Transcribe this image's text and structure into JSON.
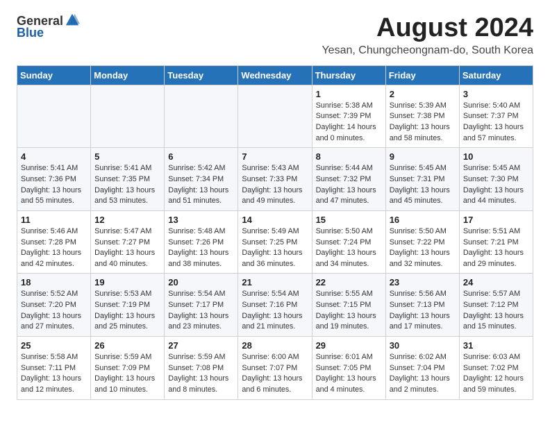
{
  "header": {
    "logo_general": "General",
    "logo_blue": "Blue",
    "month": "August 2024",
    "location": "Yesan, Chungcheongnam-do, South Korea"
  },
  "columns": [
    "Sunday",
    "Monday",
    "Tuesday",
    "Wednesday",
    "Thursday",
    "Friday",
    "Saturday"
  ],
  "rows": [
    [
      {
        "day": "",
        "info": ""
      },
      {
        "day": "",
        "info": ""
      },
      {
        "day": "",
        "info": ""
      },
      {
        "day": "",
        "info": ""
      },
      {
        "day": "1",
        "info": "Sunrise: 5:38 AM\nSunset: 7:39 PM\nDaylight: 14 hours\nand 0 minutes."
      },
      {
        "day": "2",
        "info": "Sunrise: 5:39 AM\nSunset: 7:38 PM\nDaylight: 13 hours\nand 58 minutes."
      },
      {
        "day": "3",
        "info": "Sunrise: 5:40 AM\nSunset: 7:37 PM\nDaylight: 13 hours\nand 57 minutes."
      }
    ],
    [
      {
        "day": "4",
        "info": "Sunrise: 5:41 AM\nSunset: 7:36 PM\nDaylight: 13 hours\nand 55 minutes."
      },
      {
        "day": "5",
        "info": "Sunrise: 5:41 AM\nSunset: 7:35 PM\nDaylight: 13 hours\nand 53 minutes."
      },
      {
        "day": "6",
        "info": "Sunrise: 5:42 AM\nSunset: 7:34 PM\nDaylight: 13 hours\nand 51 minutes."
      },
      {
        "day": "7",
        "info": "Sunrise: 5:43 AM\nSunset: 7:33 PM\nDaylight: 13 hours\nand 49 minutes."
      },
      {
        "day": "8",
        "info": "Sunrise: 5:44 AM\nSunset: 7:32 PM\nDaylight: 13 hours\nand 47 minutes."
      },
      {
        "day": "9",
        "info": "Sunrise: 5:45 AM\nSunset: 7:31 PM\nDaylight: 13 hours\nand 45 minutes."
      },
      {
        "day": "10",
        "info": "Sunrise: 5:45 AM\nSunset: 7:30 PM\nDaylight: 13 hours\nand 44 minutes."
      }
    ],
    [
      {
        "day": "11",
        "info": "Sunrise: 5:46 AM\nSunset: 7:28 PM\nDaylight: 13 hours\nand 42 minutes."
      },
      {
        "day": "12",
        "info": "Sunrise: 5:47 AM\nSunset: 7:27 PM\nDaylight: 13 hours\nand 40 minutes."
      },
      {
        "day": "13",
        "info": "Sunrise: 5:48 AM\nSunset: 7:26 PM\nDaylight: 13 hours\nand 38 minutes."
      },
      {
        "day": "14",
        "info": "Sunrise: 5:49 AM\nSunset: 7:25 PM\nDaylight: 13 hours\nand 36 minutes."
      },
      {
        "day": "15",
        "info": "Sunrise: 5:50 AM\nSunset: 7:24 PM\nDaylight: 13 hours\nand 34 minutes."
      },
      {
        "day": "16",
        "info": "Sunrise: 5:50 AM\nSunset: 7:22 PM\nDaylight: 13 hours\nand 32 minutes."
      },
      {
        "day": "17",
        "info": "Sunrise: 5:51 AM\nSunset: 7:21 PM\nDaylight: 13 hours\nand 29 minutes."
      }
    ],
    [
      {
        "day": "18",
        "info": "Sunrise: 5:52 AM\nSunset: 7:20 PM\nDaylight: 13 hours\nand 27 minutes."
      },
      {
        "day": "19",
        "info": "Sunrise: 5:53 AM\nSunset: 7:19 PM\nDaylight: 13 hours\nand 25 minutes."
      },
      {
        "day": "20",
        "info": "Sunrise: 5:54 AM\nSunset: 7:17 PM\nDaylight: 13 hours\nand 23 minutes."
      },
      {
        "day": "21",
        "info": "Sunrise: 5:54 AM\nSunset: 7:16 PM\nDaylight: 13 hours\nand 21 minutes."
      },
      {
        "day": "22",
        "info": "Sunrise: 5:55 AM\nSunset: 7:15 PM\nDaylight: 13 hours\nand 19 minutes."
      },
      {
        "day": "23",
        "info": "Sunrise: 5:56 AM\nSunset: 7:13 PM\nDaylight: 13 hours\nand 17 minutes."
      },
      {
        "day": "24",
        "info": "Sunrise: 5:57 AM\nSunset: 7:12 PM\nDaylight: 13 hours\nand 15 minutes."
      }
    ],
    [
      {
        "day": "25",
        "info": "Sunrise: 5:58 AM\nSunset: 7:11 PM\nDaylight: 13 hours\nand 12 minutes."
      },
      {
        "day": "26",
        "info": "Sunrise: 5:59 AM\nSunset: 7:09 PM\nDaylight: 13 hours\nand 10 minutes."
      },
      {
        "day": "27",
        "info": "Sunrise: 5:59 AM\nSunset: 7:08 PM\nDaylight: 13 hours\nand 8 minutes."
      },
      {
        "day": "28",
        "info": "Sunrise: 6:00 AM\nSunset: 7:07 PM\nDaylight: 13 hours\nand 6 minutes."
      },
      {
        "day": "29",
        "info": "Sunrise: 6:01 AM\nSunset: 7:05 PM\nDaylight: 13 hours\nand 4 minutes."
      },
      {
        "day": "30",
        "info": "Sunrise: 6:02 AM\nSunset: 7:04 PM\nDaylight: 13 hours\nand 2 minutes."
      },
      {
        "day": "31",
        "info": "Sunrise: 6:03 AM\nSunset: 7:02 PM\nDaylight: 12 hours\nand 59 minutes."
      }
    ]
  ]
}
